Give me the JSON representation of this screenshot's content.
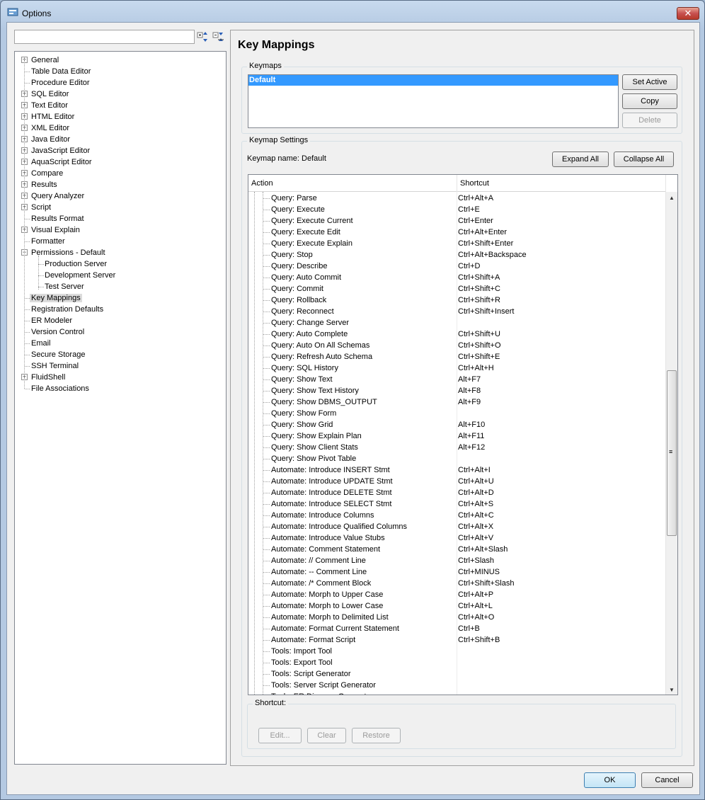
{
  "window": {
    "title": "Options",
    "close_glyph": "✕"
  },
  "search": {
    "value": "",
    "placeholder": ""
  },
  "tree": {
    "items": [
      {
        "label": "General",
        "expander": "+"
      },
      {
        "label": "Table Data Editor",
        "expander": ""
      },
      {
        "label": "Procedure Editor",
        "expander": ""
      },
      {
        "label": "SQL Editor",
        "expander": "+"
      },
      {
        "label": "Text Editor",
        "expander": "+"
      },
      {
        "label": "HTML Editor",
        "expander": "+"
      },
      {
        "label": "XML Editor",
        "expander": "+"
      },
      {
        "label": "Java Editor",
        "expander": "+"
      },
      {
        "label": "JavaScript Editor",
        "expander": "+"
      },
      {
        "label": "AquaScript Editor",
        "expander": "+"
      },
      {
        "label": "Compare",
        "expander": "+"
      },
      {
        "label": "Results",
        "expander": "+"
      },
      {
        "label": "Query Analyzer",
        "expander": "+"
      },
      {
        "label": "Script",
        "expander": "+"
      },
      {
        "label": "Results Format",
        "expander": ""
      },
      {
        "label": "Visual Explain",
        "expander": "+"
      },
      {
        "label": "Formatter",
        "expander": ""
      },
      {
        "label": "Permissions - Default",
        "expander": "−"
      },
      {
        "label": "Production Server",
        "expander": "",
        "child": true
      },
      {
        "label": "Development Server",
        "expander": "",
        "child": true
      },
      {
        "label": "Test Server",
        "expander": "",
        "child": true
      },
      {
        "label": "Key Mappings",
        "expander": "",
        "selected": true
      },
      {
        "label": "Registration Defaults",
        "expander": ""
      },
      {
        "label": "ER Modeler",
        "expander": ""
      },
      {
        "label": "Version Control",
        "expander": ""
      },
      {
        "label": "Email",
        "expander": ""
      },
      {
        "label": "Secure Storage",
        "expander": ""
      },
      {
        "label": "SSH Terminal",
        "expander": ""
      },
      {
        "label": "FluidShell",
        "expander": "+"
      },
      {
        "label": "File Associations",
        "expander": ""
      }
    ]
  },
  "page": {
    "title": "Key Mappings"
  },
  "keymaps": {
    "group_title": "Keymaps",
    "items": [
      "Default"
    ],
    "set_active_label": "Set Active",
    "copy_label": "Copy",
    "delete_label": "Delete"
  },
  "settings": {
    "group_title": "Keymap Settings",
    "keymap_name": "Keymap name: Default",
    "expand_all_label": "Expand All",
    "collapse_all_label": "Collapse All",
    "columns": [
      "Action",
      "Shortcut"
    ],
    "rows": [
      [
        "Query: Parse",
        "Ctrl+Alt+A"
      ],
      [
        "Query: Execute",
        "Ctrl+E"
      ],
      [
        "Query: Execute Current",
        "Ctrl+Enter"
      ],
      [
        "Query: Execute Edit",
        "Ctrl+Alt+Enter"
      ],
      [
        "Query: Execute Explain",
        "Ctrl+Shift+Enter"
      ],
      [
        "Query: Stop",
        "Ctrl+Alt+Backspace"
      ],
      [
        "Query: Describe",
        "Ctrl+D"
      ],
      [
        "Query: Auto Commit",
        "Ctrl+Shift+A"
      ],
      [
        "Query: Commit",
        "Ctrl+Shift+C"
      ],
      [
        "Query: Rollback",
        "Ctrl+Shift+R"
      ],
      [
        "Query: Reconnect",
        "Ctrl+Shift+Insert"
      ],
      [
        "Query: Change Server",
        ""
      ],
      [
        "Query: Auto Complete",
        "Ctrl+Shift+U"
      ],
      [
        "Query: Auto On All Schemas",
        "Ctrl+Shift+O"
      ],
      [
        "Query: Refresh Auto Schema",
        "Ctrl+Shift+E"
      ],
      [
        "Query: SQL History",
        "Ctrl+Alt+H"
      ],
      [
        "Query: Show Text",
        "Alt+F7"
      ],
      [
        "Query: Show Text History",
        "Alt+F8"
      ],
      [
        "Query: Show DBMS_OUTPUT",
        "Alt+F9"
      ],
      [
        "Query: Show Form",
        ""
      ],
      [
        "Query: Show Grid",
        "Alt+F10"
      ],
      [
        "Query: Show Explain Plan",
        "Alt+F11"
      ],
      [
        "Query: Show Client Stats",
        "Alt+F12"
      ],
      [
        "Query: Show Pivot Table",
        ""
      ],
      [
        "Automate: Introduce INSERT Stmt",
        "Ctrl+Alt+I"
      ],
      [
        "Automate: Introduce UPDATE Stmt",
        "Ctrl+Alt+U"
      ],
      [
        "Automate: Introduce DELETE Stmt",
        "Ctrl+Alt+D"
      ],
      [
        "Automate: Introduce SELECT Stmt",
        "Ctrl+Alt+S"
      ],
      [
        "Automate: Introduce Columns",
        "Ctrl+Alt+C"
      ],
      [
        "Automate: Introduce Qualified Columns",
        "Ctrl+Alt+X"
      ],
      [
        "Automate: Introduce Value Stubs",
        "Ctrl+Alt+V"
      ],
      [
        "Automate: Comment Statement",
        "Ctrl+Alt+Slash"
      ],
      [
        "Automate: // Comment Line",
        "Ctrl+Slash"
      ],
      [
        "Automate: -- Comment Line",
        "Ctrl+MINUS"
      ],
      [
        "Automate: /* Comment Block",
        "Ctrl+Shift+Slash"
      ],
      [
        "Automate: Morph to Upper Case",
        "Ctrl+Alt+P"
      ],
      [
        "Automate: Morph to Lower Case",
        "Ctrl+Alt+L"
      ],
      [
        "Automate: Morph to Delimited List",
        "Ctrl+Alt+O"
      ],
      [
        "Automate: Format Current Statement",
        "Ctrl+B"
      ],
      [
        "Automate: Format Script",
        "Ctrl+Shift+B"
      ],
      [
        "Tools: Import Tool",
        ""
      ],
      [
        "Tools: Export Tool",
        ""
      ],
      [
        "Tools: Script Generator",
        ""
      ],
      [
        "Tools: Server Script Generator",
        ""
      ],
      [
        "Tools: ER Diagram Generator",
        ""
      ]
    ]
  },
  "shortcut": {
    "group_title": "Shortcut:",
    "edit_label": "Edit...",
    "clear_label": "Clear",
    "restore_label": "Restore"
  },
  "dialog": {
    "ok_label": "OK",
    "cancel_label": "Cancel"
  },
  "colors": {
    "selection": "#3399ff",
    "accent_border": "#3c7fb1"
  }
}
